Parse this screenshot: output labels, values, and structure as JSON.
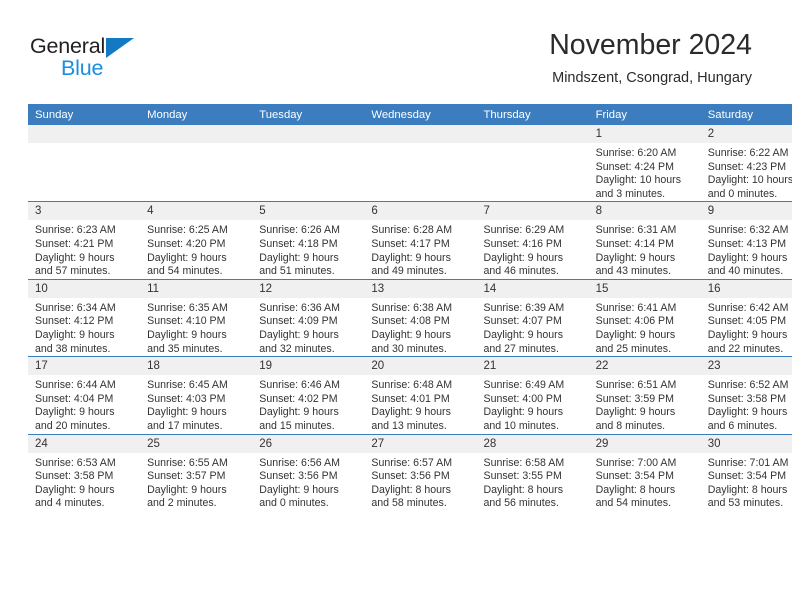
{
  "brand": {
    "name_primary": "General",
    "name_secondary": "Blue",
    "triangle_icon": "triangle-icon",
    "accent_color": "#1279c2",
    "secondary_color": "#1a8ee0"
  },
  "header": {
    "title": "November 2024",
    "subtitle": "Mindszent, Csongrad, Hungary"
  },
  "theme": {
    "header_bg": "#3b7dbf",
    "header_text": "#ffffff",
    "daynum_bg": "#f0f0f0",
    "cell_border": "#3b7dbf",
    "body_text": "#333333"
  },
  "calendar": {
    "weekday_headers": [
      "Sunday",
      "Monday",
      "Tuesday",
      "Wednesday",
      "Thursday",
      "Friday",
      "Saturday"
    ],
    "weeks": [
      [
        {
          "day": "",
          "lines": []
        },
        {
          "day": "",
          "lines": []
        },
        {
          "day": "",
          "lines": []
        },
        {
          "day": "",
          "lines": []
        },
        {
          "day": "",
          "lines": []
        },
        {
          "day": "1",
          "lines": [
            "Sunrise: 6:20 AM",
            "Sunset: 4:24 PM",
            "Daylight: 10 hours",
            "and 3 minutes."
          ]
        },
        {
          "day": "2",
          "lines": [
            "Sunrise: 6:22 AM",
            "Sunset: 4:23 PM",
            "Daylight: 10 hours",
            "and 0 minutes."
          ]
        }
      ],
      [
        {
          "day": "3",
          "lines": [
            "Sunrise: 6:23 AM",
            "Sunset: 4:21 PM",
            "Daylight: 9 hours",
            "and 57 minutes."
          ]
        },
        {
          "day": "4",
          "lines": [
            "Sunrise: 6:25 AM",
            "Sunset: 4:20 PM",
            "Daylight: 9 hours",
            "and 54 minutes."
          ]
        },
        {
          "day": "5",
          "lines": [
            "Sunrise: 6:26 AM",
            "Sunset: 4:18 PM",
            "Daylight: 9 hours",
            "and 51 minutes."
          ]
        },
        {
          "day": "6",
          "lines": [
            "Sunrise: 6:28 AM",
            "Sunset: 4:17 PM",
            "Daylight: 9 hours",
            "and 49 minutes."
          ]
        },
        {
          "day": "7",
          "lines": [
            "Sunrise: 6:29 AM",
            "Sunset: 4:16 PM",
            "Daylight: 9 hours",
            "and 46 minutes."
          ]
        },
        {
          "day": "8",
          "lines": [
            "Sunrise: 6:31 AM",
            "Sunset: 4:14 PM",
            "Daylight: 9 hours",
            "and 43 minutes."
          ]
        },
        {
          "day": "9",
          "lines": [
            "Sunrise: 6:32 AM",
            "Sunset: 4:13 PM",
            "Daylight: 9 hours",
            "and 40 minutes."
          ]
        }
      ],
      [
        {
          "day": "10",
          "lines": [
            "Sunrise: 6:34 AM",
            "Sunset: 4:12 PM",
            "Daylight: 9 hours",
            "and 38 minutes."
          ]
        },
        {
          "day": "11",
          "lines": [
            "Sunrise: 6:35 AM",
            "Sunset: 4:10 PM",
            "Daylight: 9 hours",
            "and 35 minutes."
          ]
        },
        {
          "day": "12",
          "lines": [
            "Sunrise: 6:36 AM",
            "Sunset: 4:09 PM",
            "Daylight: 9 hours",
            "and 32 minutes."
          ]
        },
        {
          "day": "13",
          "lines": [
            "Sunrise: 6:38 AM",
            "Sunset: 4:08 PM",
            "Daylight: 9 hours",
            "and 30 minutes."
          ]
        },
        {
          "day": "14",
          "lines": [
            "Sunrise: 6:39 AM",
            "Sunset: 4:07 PM",
            "Daylight: 9 hours",
            "and 27 minutes."
          ]
        },
        {
          "day": "15",
          "lines": [
            "Sunrise: 6:41 AM",
            "Sunset: 4:06 PM",
            "Daylight: 9 hours",
            "and 25 minutes."
          ]
        },
        {
          "day": "16",
          "lines": [
            "Sunrise: 6:42 AM",
            "Sunset: 4:05 PM",
            "Daylight: 9 hours",
            "and 22 minutes."
          ]
        }
      ],
      [
        {
          "day": "17",
          "lines": [
            "Sunrise: 6:44 AM",
            "Sunset: 4:04 PM",
            "Daylight: 9 hours",
            "and 20 minutes."
          ]
        },
        {
          "day": "18",
          "lines": [
            "Sunrise: 6:45 AM",
            "Sunset: 4:03 PM",
            "Daylight: 9 hours",
            "and 17 minutes."
          ]
        },
        {
          "day": "19",
          "lines": [
            "Sunrise: 6:46 AM",
            "Sunset: 4:02 PM",
            "Daylight: 9 hours",
            "and 15 minutes."
          ]
        },
        {
          "day": "20",
          "lines": [
            "Sunrise: 6:48 AM",
            "Sunset: 4:01 PM",
            "Daylight: 9 hours",
            "and 13 minutes."
          ]
        },
        {
          "day": "21",
          "lines": [
            "Sunrise: 6:49 AM",
            "Sunset: 4:00 PM",
            "Daylight: 9 hours",
            "and 10 minutes."
          ]
        },
        {
          "day": "22",
          "lines": [
            "Sunrise: 6:51 AM",
            "Sunset: 3:59 PM",
            "Daylight: 9 hours",
            "and 8 minutes."
          ]
        },
        {
          "day": "23",
          "lines": [
            "Sunrise: 6:52 AM",
            "Sunset: 3:58 PM",
            "Daylight: 9 hours",
            "and 6 minutes."
          ]
        }
      ],
      [
        {
          "day": "24",
          "lines": [
            "Sunrise: 6:53 AM",
            "Sunset: 3:58 PM",
            "Daylight: 9 hours",
            "and 4 minutes."
          ]
        },
        {
          "day": "25",
          "lines": [
            "Sunrise: 6:55 AM",
            "Sunset: 3:57 PM",
            "Daylight: 9 hours",
            "and 2 minutes."
          ]
        },
        {
          "day": "26",
          "lines": [
            "Sunrise: 6:56 AM",
            "Sunset: 3:56 PM",
            "Daylight: 9 hours",
            "and 0 minutes."
          ]
        },
        {
          "day": "27",
          "lines": [
            "Sunrise: 6:57 AM",
            "Sunset: 3:56 PM",
            "Daylight: 8 hours",
            "and 58 minutes."
          ]
        },
        {
          "day": "28",
          "lines": [
            "Sunrise: 6:58 AM",
            "Sunset: 3:55 PM",
            "Daylight: 8 hours",
            "and 56 minutes."
          ]
        },
        {
          "day": "29",
          "lines": [
            "Sunrise: 7:00 AM",
            "Sunset: 3:54 PM",
            "Daylight: 8 hours",
            "and 54 minutes."
          ]
        },
        {
          "day": "30",
          "lines": [
            "Sunrise: 7:01 AM",
            "Sunset: 3:54 PM",
            "Daylight: 8 hours",
            "and 53 minutes."
          ]
        }
      ]
    ]
  }
}
